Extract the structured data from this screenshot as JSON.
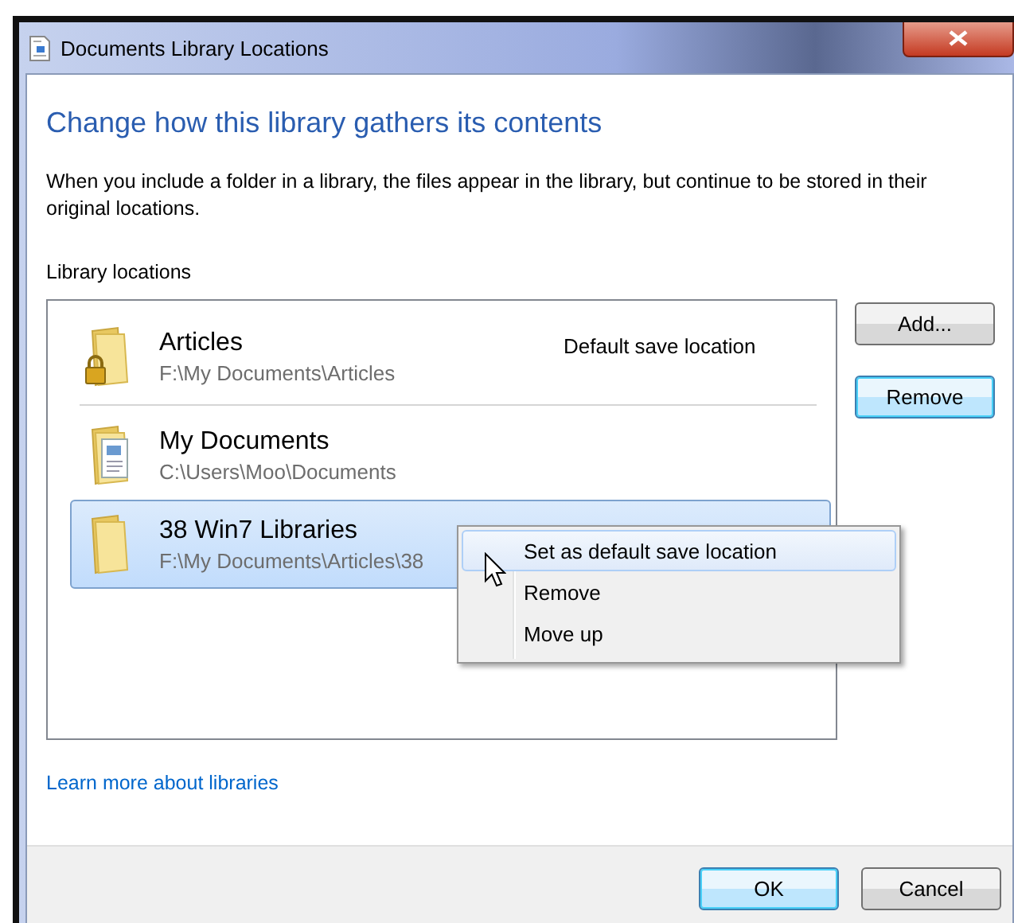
{
  "window": {
    "title": "Documents Library Locations"
  },
  "heading": "Change how this library gathers its contents",
  "description": "When you include a folder in a library, the files appear in the library, but continue to be stored in their original locations.",
  "locations_label": "Library locations",
  "locations": [
    {
      "kind": "locked",
      "name": "Articles",
      "path": "F:\\My Documents\\Articles",
      "status": "Default save location",
      "selected": false
    },
    {
      "kind": "documents",
      "name": "My Documents",
      "path": "C:\\Users\\Moo\\Documents",
      "selected": false
    },
    {
      "kind": "plain",
      "name": "38 Win7 Libraries",
      "path": "F:\\My Documents\\Articles\\38",
      "selected": true
    }
  ],
  "side_buttons": [
    {
      "label": "Add...",
      "highlighted": false
    },
    {
      "label": "Remove",
      "highlighted": true
    }
  ],
  "context_menu": [
    {
      "label": "Set as default save location",
      "selected": true
    },
    {
      "label": "Remove",
      "selected": false
    },
    {
      "label": "Move up",
      "selected": false
    }
  ],
  "link": "Learn more about libraries",
  "footer_buttons": [
    {
      "label": "OK",
      "highlighted": true
    },
    {
      "label": "Cancel",
      "highlighted": false
    }
  ]
}
